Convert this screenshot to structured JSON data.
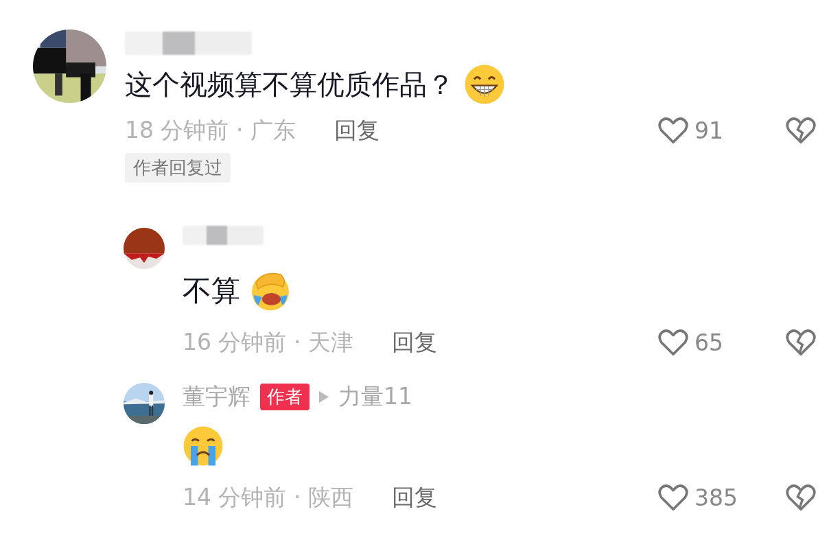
{
  "comments": [
    {
      "name_hidden": true,
      "text": "这个视频算不算优质作品？",
      "emoji": {
        "kind": "grin"
      },
      "time_place": "18 分钟前 · 广东",
      "reply_label": "回复",
      "likes": "91",
      "author_replied": "作者回复过",
      "replies": [
        {
          "name_hidden": true,
          "text": "不算",
          "emoji": {
            "kind": "facepalm"
          },
          "time_place": "16 分钟前 · 天津",
          "reply_label": "回复",
          "likes": "65"
        },
        {
          "name": "董宇辉",
          "author_badge": "作者",
          "level": "力量11",
          "emoji": {
            "kind": "cry"
          },
          "time_place": "14 分钟前 · 陕西",
          "reply_label": "回复",
          "likes": "385"
        }
      ]
    }
  ]
}
